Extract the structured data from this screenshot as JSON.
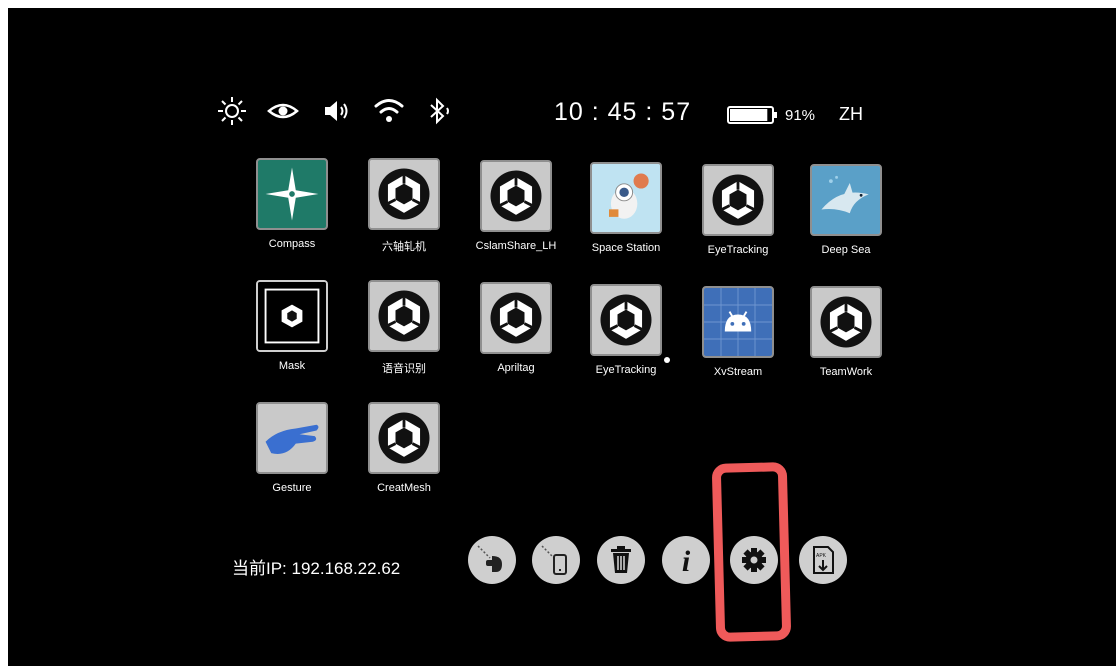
{
  "status_bar": {
    "icons": [
      "brightness-icon",
      "eye-icon",
      "volume-icon",
      "wifi-icon",
      "bluetooth-icon"
    ],
    "time": "10 : 45 : 57",
    "battery_percent": "91%",
    "battery_level": 0.91,
    "language": "ZH"
  },
  "apps": [
    {
      "label": "Compass",
      "icon": "compass-icon"
    },
    {
      "label": "六轴轧机",
      "icon": "unity-icon"
    },
    {
      "label": "CslamShare_LH",
      "icon": "unity-icon"
    },
    {
      "label": "Space Station",
      "icon": "astronaut-icon"
    },
    {
      "label": "EyeTracking",
      "icon": "unity-icon"
    },
    {
      "label": "Deep Sea",
      "icon": "shark-icon"
    },
    {
      "label": "Mask",
      "icon": "unity-icon"
    },
    {
      "label": "语音识别",
      "icon": "unity-icon"
    },
    {
      "label": "Apriltag",
      "icon": "unity-icon"
    },
    {
      "label": "EyeTracking",
      "icon": "unity-icon"
    },
    {
      "label": "XvStream",
      "icon": "android-icon"
    },
    {
      "label": "TeamWork",
      "icon": "unity-icon"
    },
    {
      "label": "Gesture",
      "icon": "hand-icon"
    },
    {
      "label": "CreatMesh",
      "icon": "unity-icon"
    }
  ],
  "footer": {
    "ip_text": "当前IP:  192.168.22.62",
    "tools": [
      "headset-connect-icon",
      "phone-connect-icon",
      "trash-icon",
      "info-icon",
      "settings-icon",
      "apk-install-icon"
    ]
  },
  "annotation": {
    "color": "#ef5a5a",
    "target": "settings-button"
  }
}
